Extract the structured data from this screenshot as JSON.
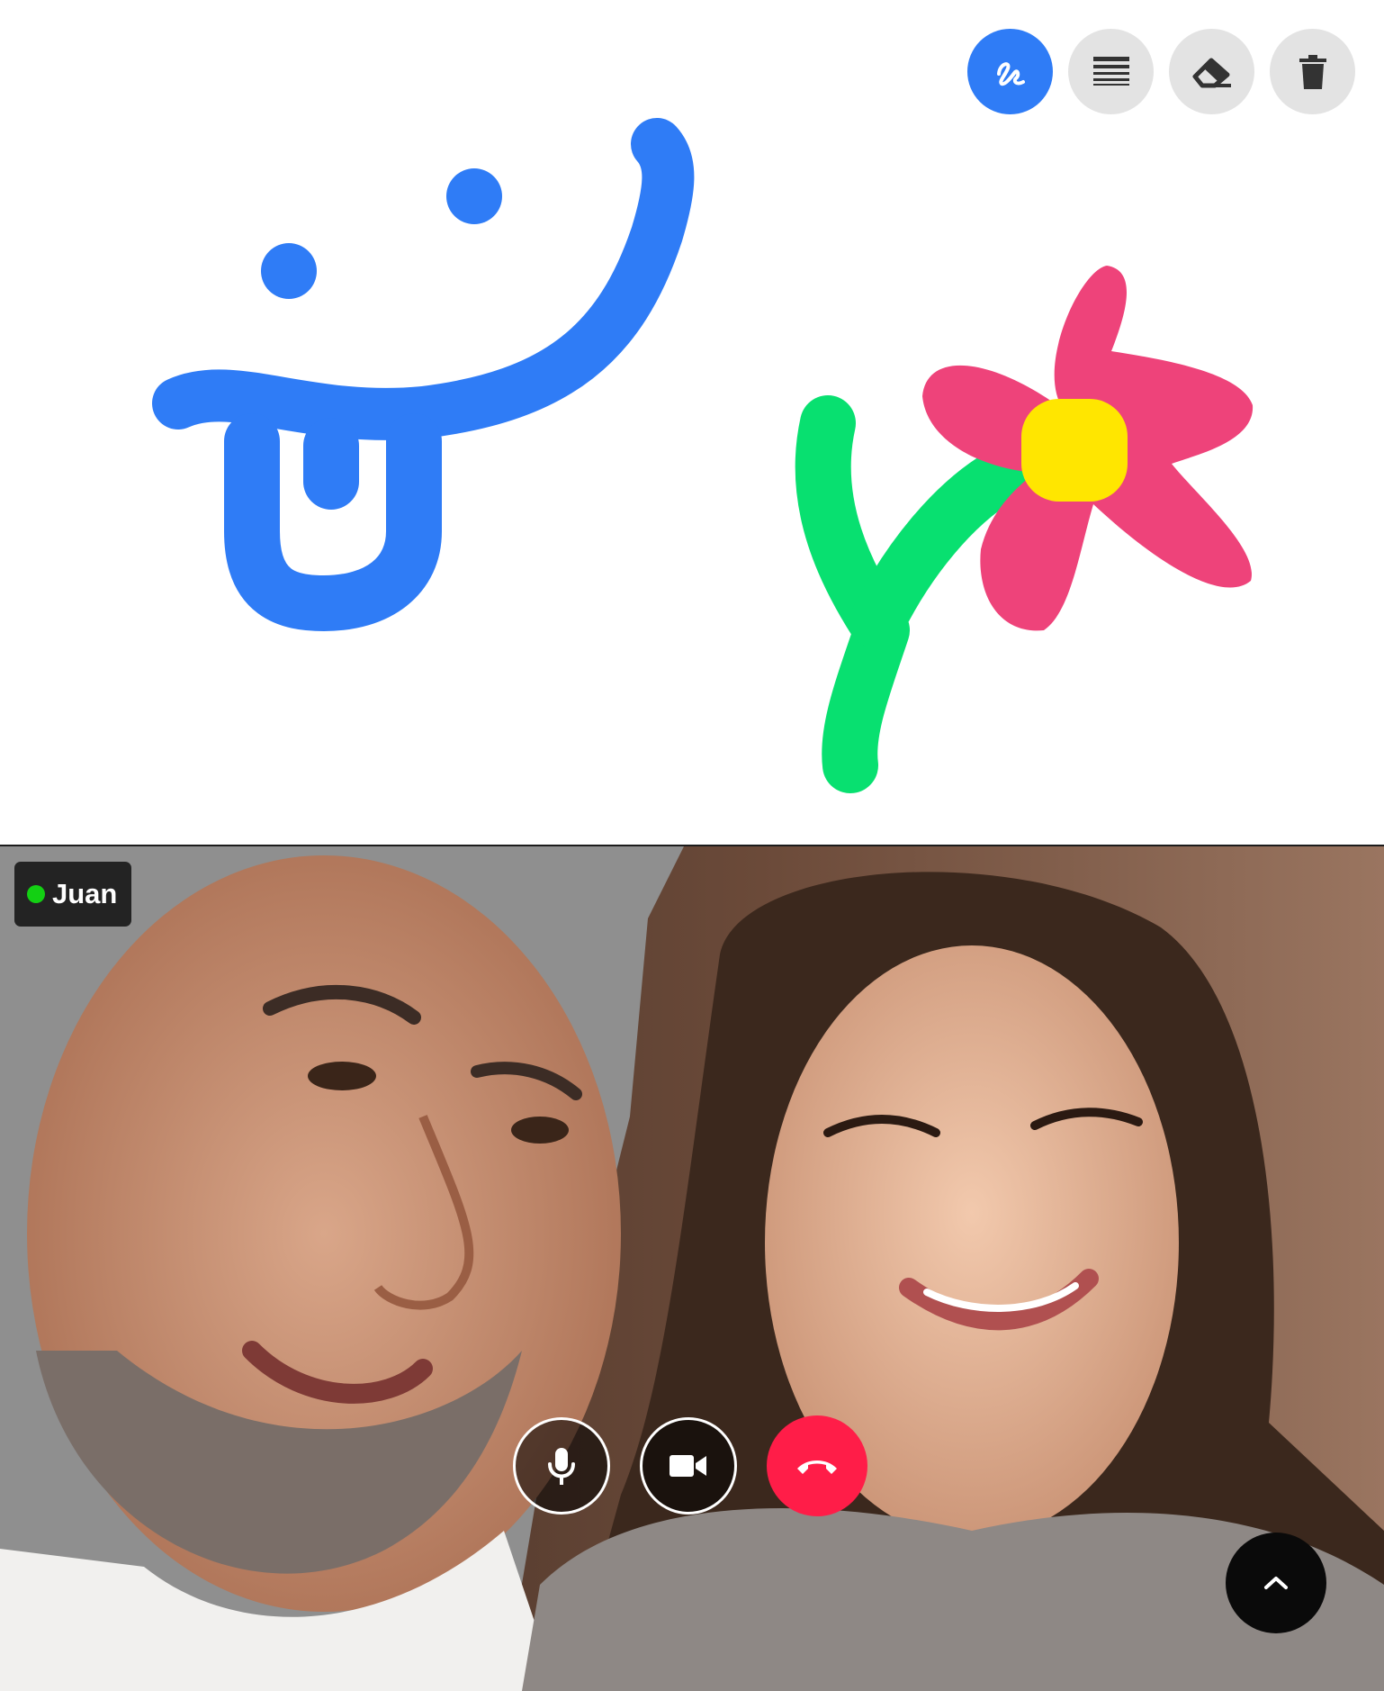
{
  "toolbar": {
    "tools": [
      {
        "id": "pen",
        "icon": "pen-scribble-icon",
        "active": true
      },
      {
        "id": "stroke-width",
        "icon": "stroke-width-icon",
        "active": false
      },
      {
        "id": "eraser",
        "icon": "eraser-icon",
        "active": false
      },
      {
        "id": "delete",
        "icon": "trash-icon",
        "active": false
      }
    ],
    "colors": {
      "active": "#2f7cf6",
      "inactive": "#e3e3e3",
      "icon": "#333333"
    }
  },
  "drawing": {
    "strokes": [
      {
        "name": "smiley-face",
        "color": "#2f7cf6"
      },
      {
        "name": "flower-stem",
        "color": "#08e070"
      },
      {
        "name": "flower-petals",
        "color": "#ee437a"
      },
      {
        "name": "flower-center",
        "color": "#ffe600"
      }
    ]
  },
  "video": {
    "participant": {
      "name": "Juan",
      "status_color": "#13d013"
    },
    "controls": {
      "mic_icon": "microphone-icon",
      "camera_icon": "video-camera-icon",
      "end_call_icon": "phone-hangup-icon",
      "end_call_color": "#ff1d48",
      "expand_icon": "chevron-up-icon"
    }
  }
}
